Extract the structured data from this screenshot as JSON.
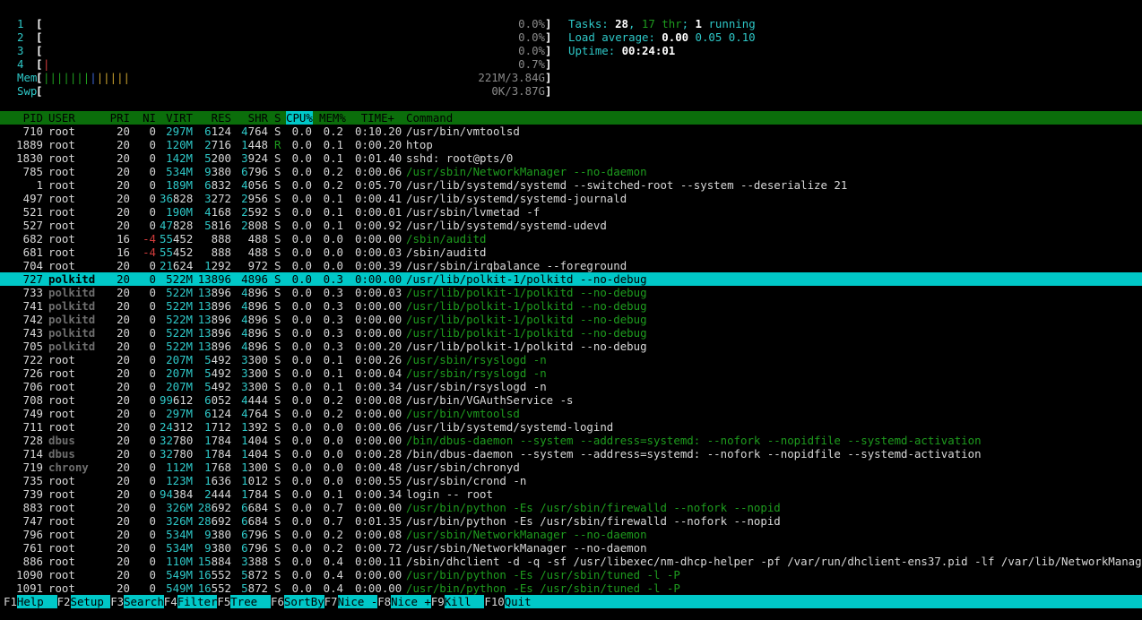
{
  "meters": {
    "cpus": [
      {
        "label": "1",
        "bar": "",
        "value": "0.0%"
      },
      {
        "label": "2",
        "bar": "",
        "value": "0.0%"
      },
      {
        "label": "3",
        "bar": "",
        "value": "0.0%"
      },
      {
        "label": "4",
        "bar": "|",
        "value": "0.7%"
      }
    ],
    "mem": {
      "label": "Mem",
      "bar": "|||||||||||||",
      "value": "221M/3.84G"
    },
    "swp": {
      "label": "Swp",
      "bar": "",
      "value": "0K/3.87G"
    },
    "open_bracket": "[",
    "close_bracket": "]"
  },
  "summary": {
    "tasks_label": "Tasks: ",
    "tasks": "28",
    "comma": ", ",
    "threads": "17",
    "thr_label": " thr",
    "sep": "; ",
    "running": "1",
    "running_label": " running",
    "load_label": "Load average: ",
    "load1": "0.00",
    "load5": "0.05",
    "load15": "0.10",
    "uptime_label": "Uptime: ",
    "uptime": "00:24:01"
  },
  "columns": {
    "pid": "PID",
    "user": "USER",
    "pri": "PRI",
    "ni": "NI",
    "virt": "VIRT",
    "res": "RES",
    "shr": "SHR",
    "s": "S",
    "cpu": "CPU%",
    "mem": "MEM%",
    "time": "TIME+",
    "command": "Command"
  },
  "processes": [
    {
      "pid": "710",
      "user": "root",
      "pri": "20",
      "ni": "0",
      "virt": "297M",
      "res": "6124",
      "shr": "4764",
      "s": "S",
      "cpu": "0.0",
      "mem": "0.2",
      "time": "0:10.20",
      "cmd": "/usr/bin/vmtoolsd",
      "thread": false
    },
    {
      "pid": "1889",
      "user": "root",
      "pri": "20",
      "ni": "0",
      "virt": "120M",
      "res": "2716",
      "shr": "1448",
      "s": "R",
      "cpu": "0.0",
      "mem": "0.1",
      "time": "0:00.20",
      "cmd": "htop",
      "thread": false
    },
    {
      "pid": "1830",
      "user": "root",
      "pri": "20",
      "ni": "0",
      "virt": "142M",
      "res": "5200",
      "shr": "3924",
      "s": "S",
      "cpu": "0.0",
      "mem": "0.1",
      "time": "0:01.40",
      "cmd": "sshd: root@pts/0",
      "thread": false
    },
    {
      "pid": "785",
      "user": "root",
      "pri": "20",
      "ni": "0",
      "virt": "534M",
      "res": "9380",
      "shr": "6796",
      "s": "S",
      "cpu": "0.0",
      "mem": "0.2",
      "time": "0:00.06",
      "cmd": "/usr/sbin/NetworkManager --no-daemon",
      "thread": true
    },
    {
      "pid": "1",
      "user": "root",
      "pri": "20",
      "ni": "0",
      "virt": "189M",
      "res": "6832",
      "shr": "4056",
      "s": "S",
      "cpu": "0.0",
      "mem": "0.2",
      "time": "0:05.70",
      "cmd": "/usr/lib/systemd/systemd --switched-root --system --deserialize 21",
      "thread": false
    },
    {
      "pid": "497",
      "user": "root",
      "pri": "20",
      "ni": "0",
      "virt": "36828",
      "res": "3272",
      "shr": "2956",
      "s": "S",
      "cpu": "0.0",
      "mem": "0.1",
      "time": "0:00.41",
      "cmd": "/usr/lib/systemd/systemd-journald",
      "thread": false
    },
    {
      "pid": "521",
      "user": "root",
      "pri": "20",
      "ni": "0",
      "virt": "190M",
      "res": "4168",
      "shr": "2592",
      "s": "S",
      "cpu": "0.0",
      "mem": "0.1",
      "time": "0:00.01",
      "cmd": "/usr/sbin/lvmetad -f",
      "thread": false
    },
    {
      "pid": "527",
      "user": "root",
      "pri": "20",
      "ni": "0",
      "virt": "47828",
      "res": "5816",
      "shr": "2808",
      "s": "S",
      "cpu": "0.0",
      "mem": "0.1",
      "time": "0:00.92",
      "cmd": "/usr/lib/systemd/systemd-udevd",
      "thread": false
    },
    {
      "pid": "682",
      "user": "root",
      "pri": "16",
      "ni": "-4",
      "virt": "55452",
      "res": "888",
      "shr": "488",
      "s": "S",
      "cpu": "0.0",
      "mem": "0.0",
      "time": "0:00.00",
      "cmd": "/sbin/auditd",
      "thread": true
    },
    {
      "pid": "681",
      "user": "root",
      "pri": "16",
      "ni": "-4",
      "virt": "55452",
      "res": "888",
      "shr": "488",
      "s": "S",
      "cpu": "0.0",
      "mem": "0.0",
      "time": "0:00.03",
      "cmd": "/sbin/auditd",
      "thread": false
    },
    {
      "pid": "704",
      "user": "root",
      "pri": "20",
      "ni": "0",
      "virt": "21624",
      "res": "1292",
      "shr": "972",
      "s": "S",
      "cpu": "0.0",
      "mem": "0.0",
      "time": "0:00.39",
      "cmd": "/usr/sbin/irqbalance --foreground",
      "thread": false
    },
    {
      "pid": "727",
      "user": "polkitd",
      "pri": "20",
      "ni": "0",
      "virt": "522M",
      "res": "13896",
      "shr": "4896",
      "s": "S",
      "cpu": "0.0",
      "mem": "0.3",
      "time": "0:00.00",
      "cmd": "/usr/lib/polkit-1/polkitd --no-debug",
      "thread": true,
      "selected": true
    },
    {
      "pid": "733",
      "user": "polkitd",
      "pri": "20",
      "ni": "0",
      "virt": "522M",
      "res": "13896",
      "shr": "4896",
      "s": "S",
      "cpu": "0.0",
      "mem": "0.3",
      "time": "0:00.03",
      "cmd": "/usr/lib/polkit-1/polkitd --no-debug",
      "thread": true
    },
    {
      "pid": "741",
      "user": "polkitd",
      "pri": "20",
      "ni": "0",
      "virt": "522M",
      "res": "13896",
      "shr": "4896",
      "s": "S",
      "cpu": "0.0",
      "mem": "0.3",
      "time": "0:00.00",
      "cmd": "/usr/lib/polkit-1/polkitd --no-debug",
      "thread": true
    },
    {
      "pid": "742",
      "user": "polkitd",
      "pri": "20",
      "ni": "0",
      "virt": "522M",
      "res": "13896",
      "shr": "4896",
      "s": "S",
      "cpu": "0.0",
      "mem": "0.3",
      "time": "0:00.00",
      "cmd": "/usr/lib/polkit-1/polkitd --no-debug",
      "thread": true
    },
    {
      "pid": "743",
      "user": "polkitd",
      "pri": "20",
      "ni": "0",
      "virt": "522M",
      "res": "13896",
      "shr": "4896",
      "s": "S",
      "cpu": "0.0",
      "mem": "0.3",
      "time": "0:00.00",
      "cmd": "/usr/lib/polkit-1/polkitd --no-debug",
      "thread": true
    },
    {
      "pid": "705",
      "user": "polkitd",
      "pri": "20",
      "ni": "0",
      "virt": "522M",
      "res": "13896",
      "shr": "4896",
      "s": "S",
      "cpu": "0.0",
      "mem": "0.3",
      "time": "0:00.20",
      "cmd": "/usr/lib/polkit-1/polkitd --no-debug",
      "thread": false
    },
    {
      "pid": "722",
      "user": "root",
      "pri": "20",
      "ni": "0",
      "virt": "207M",
      "res": "5492",
      "shr": "3300",
      "s": "S",
      "cpu": "0.0",
      "mem": "0.1",
      "time": "0:00.26",
      "cmd": "/usr/sbin/rsyslogd -n",
      "thread": true
    },
    {
      "pid": "726",
      "user": "root",
      "pri": "20",
      "ni": "0",
      "virt": "207M",
      "res": "5492",
      "shr": "3300",
      "s": "S",
      "cpu": "0.0",
      "mem": "0.1",
      "time": "0:00.04",
      "cmd": "/usr/sbin/rsyslogd -n",
      "thread": true
    },
    {
      "pid": "706",
      "user": "root",
      "pri": "20",
      "ni": "0",
      "virt": "207M",
      "res": "5492",
      "shr": "3300",
      "s": "S",
      "cpu": "0.0",
      "mem": "0.1",
      "time": "0:00.34",
      "cmd": "/usr/sbin/rsyslogd -n",
      "thread": false
    },
    {
      "pid": "708",
      "user": "root",
      "pri": "20",
      "ni": "0",
      "virt": "99612",
      "res": "6052",
      "shr": "4444",
      "s": "S",
      "cpu": "0.0",
      "mem": "0.2",
      "time": "0:00.08",
      "cmd": "/usr/bin/VGAuthService -s",
      "thread": false
    },
    {
      "pid": "749",
      "user": "root",
      "pri": "20",
      "ni": "0",
      "virt": "297M",
      "res": "6124",
      "shr": "4764",
      "s": "S",
      "cpu": "0.0",
      "mem": "0.2",
      "time": "0:00.00",
      "cmd": "/usr/bin/vmtoolsd",
      "thread": true
    },
    {
      "pid": "711",
      "user": "root",
      "pri": "20",
      "ni": "0",
      "virt": "24312",
      "res": "1712",
      "shr": "1392",
      "s": "S",
      "cpu": "0.0",
      "mem": "0.0",
      "time": "0:00.06",
      "cmd": "/usr/lib/systemd/systemd-logind",
      "thread": false
    },
    {
      "pid": "728",
      "user": "dbus",
      "pri": "20",
      "ni": "0",
      "virt": "32780",
      "res": "1784",
      "shr": "1404",
      "s": "S",
      "cpu": "0.0",
      "mem": "0.0",
      "time": "0:00.00",
      "cmd": "/bin/dbus-daemon --system --address=systemd: --nofork --nopidfile --systemd-activation",
      "thread": true
    },
    {
      "pid": "714",
      "user": "dbus",
      "pri": "20",
      "ni": "0",
      "virt": "32780",
      "res": "1784",
      "shr": "1404",
      "s": "S",
      "cpu": "0.0",
      "mem": "0.0",
      "time": "0:00.28",
      "cmd": "/bin/dbus-daemon --system --address=systemd: --nofork --nopidfile --systemd-activation",
      "thread": false
    },
    {
      "pid": "719",
      "user": "chrony",
      "pri": "20",
      "ni": "0",
      "virt": "112M",
      "res": "1768",
      "shr": "1300",
      "s": "S",
      "cpu": "0.0",
      "mem": "0.0",
      "time": "0:00.48",
      "cmd": "/usr/sbin/chronyd",
      "thread": false
    },
    {
      "pid": "735",
      "user": "root",
      "pri": "20",
      "ni": "0",
      "virt": "123M",
      "res": "1636",
      "shr": "1012",
      "s": "S",
      "cpu": "0.0",
      "mem": "0.0",
      "time": "0:00.55",
      "cmd": "/usr/sbin/crond -n",
      "thread": false
    },
    {
      "pid": "739",
      "user": "root",
      "pri": "20",
      "ni": "0",
      "virt": "94384",
      "res": "2444",
      "shr": "1784",
      "s": "S",
      "cpu": "0.0",
      "mem": "0.1",
      "time": "0:00.34",
      "cmd": "login -- root",
      "thread": false
    },
    {
      "pid": "883",
      "user": "root",
      "pri": "20",
      "ni": "0",
      "virt": "326M",
      "res": "28692",
      "shr": "6684",
      "s": "S",
      "cpu": "0.0",
      "mem": "0.7",
      "time": "0:00.00",
      "cmd": "/usr/bin/python -Es /usr/sbin/firewalld --nofork --nopid",
      "thread": true
    },
    {
      "pid": "747",
      "user": "root",
      "pri": "20",
      "ni": "0",
      "virt": "326M",
      "res": "28692",
      "shr": "6684",
      "s": "S",
      "cpu": "0.0",
      "mem": "0.7",
      "time": "0:01.35",
      "cmd": "/usr/bin/python -Es /usr/sbin/firewalld --nofork --nopid",
      "thread": false
    },
    {
      "pid": "796",
      "user": "root",
      "pri": "20",
      "ni": "0",
      "virt": "534M",
      "res": "9380",
      "shr": "6796",
      "s": "S",
      "cpu": "0.0",
      "mem": "0.2",
      "time": "0:00.08",
      "cmd": "/usr/sbin/NetworkManager --no-daemon",
      "thread": true
    },
    {
      "pid": "761",
      "user": "root",
      "pri": "20",
      "ni": "0",
      "virt": "534M",
      "res": "9380",
      "shr": "6796",
      "s": "S",
      "cpu": "0.0",
      "mem": "0.2",
      "time": "0:00.72",
      "cmd": "/usr/sbin/NetworkManager --no-daemon",
      "thread": false
    },
    {
      "pid": "886",
      "user": "root",
      "pri": "20",
      "ni": "0",
      "virt": "110M",
      "res": "15884",
      "shr": "3388",
      "s": "S",
      "cpu": "0.0",
      "mem": "0.4",
      "time": "0:00.11",
      "cmd": "/sbin/dhclient -d -q -sf /usr/libexec/nm-dhcp-helper -pf /var/run/dhclient-ens37.pid -lf /var/lib/NetworkManager/dhc",
      "thread": false
    },
    {
      "pid": "1090",
      "user": "root",
      "pri": "20",
      "ni": "0",
      "virt": "549M",
      "res": "16552",
      "shr": "5872",
      "s": "S",
      "cpu": "0.0",
      "mem": "0.4",
      "time": "0:00.00",
      "cmd": "/usr/bin/python -Es /usr/sbin/tuned -l -P",
      "thread": true
    },
    {
      "pid": "1091",
      "user": "root",
      "pri": "20",
      "ni": "0",
      "virt": "549M",
      "res": "16552",
      "shr": "5872",
      "s": "S",
      "cpu": "0.0",
      "mem": "0.4",
      "time": "0:00.00",
      "cmd": "/usr/bin/python -Es /usr/sbin/tuned -l -P",
      "thread": true
    }
  ],
  "footer": [
    {
      "key": "F1",
      "label": "Help  "
    },
    {
      "key": "F2",
      "label": "Setup "
    },
    {
      "key": "F3",
      "label": "Search"
    },
    {
      "key": "F4",
      "label": "Filter"
    },
    {
      "key": "F5",
      "label": "Tree  "
    },
    {
      "key": "F6",
      "label": "SortBy"
    },
    {
      "key": "F7",
      "label": "Nice -"
    },
    {
      "key": "F8",
      "label": "Nice +"
    },
    {
      "key": "F9",
      "label": "Kill  "
    },
    {
      "key": "F10",
      "label": "Quit"
    }
  ],
  "colors": {
    "header_bg": "#0b6e0b",
    "selected_bg": "#00c8c8",
    "thread_fg": "#1e9c1e",
    "cyan": "#2ec8c8"
  }
}
